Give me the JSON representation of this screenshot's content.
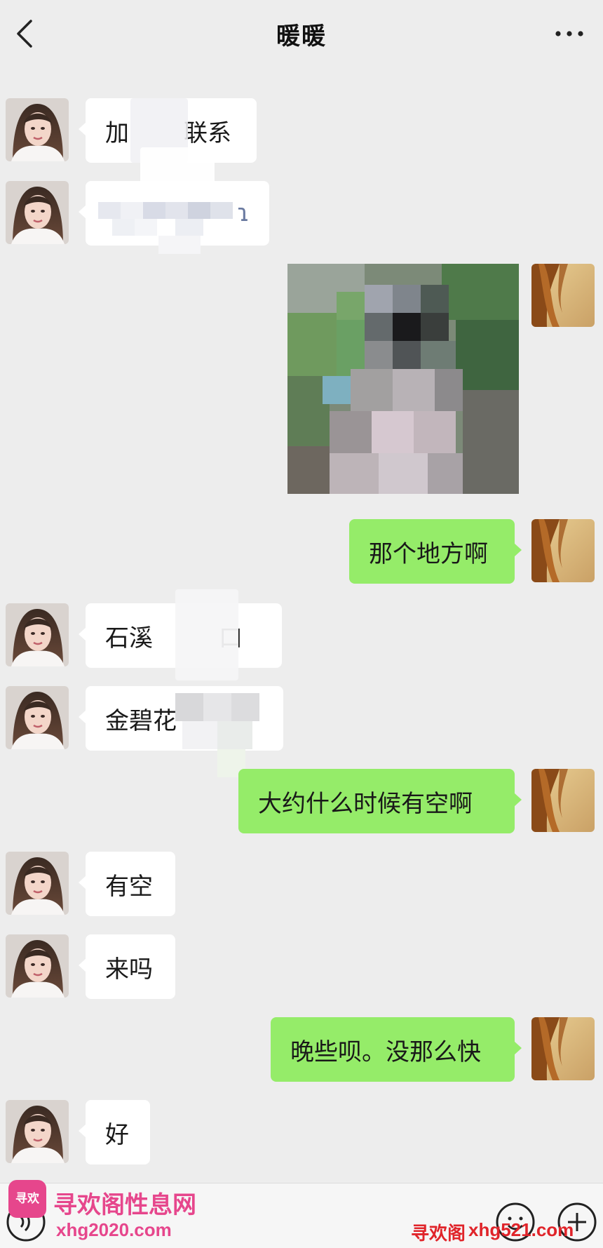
{
  "header": {
    "title": "暖暖",
    "back_icon": "chevron-left-icon",
    "more_icon": "more-dots-icon"
  },
  "messages": [
    {
      "side": "in",
      "text": "加 联系"
    },
    {
      "side": "in",
      "text": "ɿ"
    },
    {
      "side": "out",
      "type": "image"
    },
    {
      "side": "out",
      "text": "那个地方啊"
    },
    {
      "side": "in",
      "text": "石溪 口"
    },
    {
      "side": "in",
      "text": "金碧花 "
    },
    {
      "side": "out",
      "text": "大约什么时候有空啊"
    },
    {
      "side": "in",
      "text": "有空"
    },
    {
      "side": "in",
      "text": "来吗"
    },
    {
      "side": "out",
      "text": "晚些呗。没那么快"
    },
    {
      "side": "in",
      "text": "好"
    }
  ],
  "bubble_text": {
    "m1a": "加",
    "m1b": "联系",
    "m2": "ɿ",
    "m4": "那个地方啊",
    "m5a": "石溪",
    "m5b": "口",
    "m6": "金碧花",
    "m7": "大约什么时候有空啊",
    "m8": "有空",
    "m9": "来吗",
    "m10": "晚些呗。没那么快",
    "m11": "好"
  },
  "watermark": {
    "logo_text": "寻欢",
    "site_name": "寻欢阁性息网",
    "domain1": "xhg2020.com",
    "domain2_prefix": "寻欢阁",
    "domain2": "xhg521.com"
  },
  "colors": {
    "background": "#ededed",
    "incoming_bubble": "#ffffff",
    "outgoing_bubble": "#95ec69",
    "watermark_pink": "#e6468c",
    "watermark_red": "#e0242a"
  }
}
